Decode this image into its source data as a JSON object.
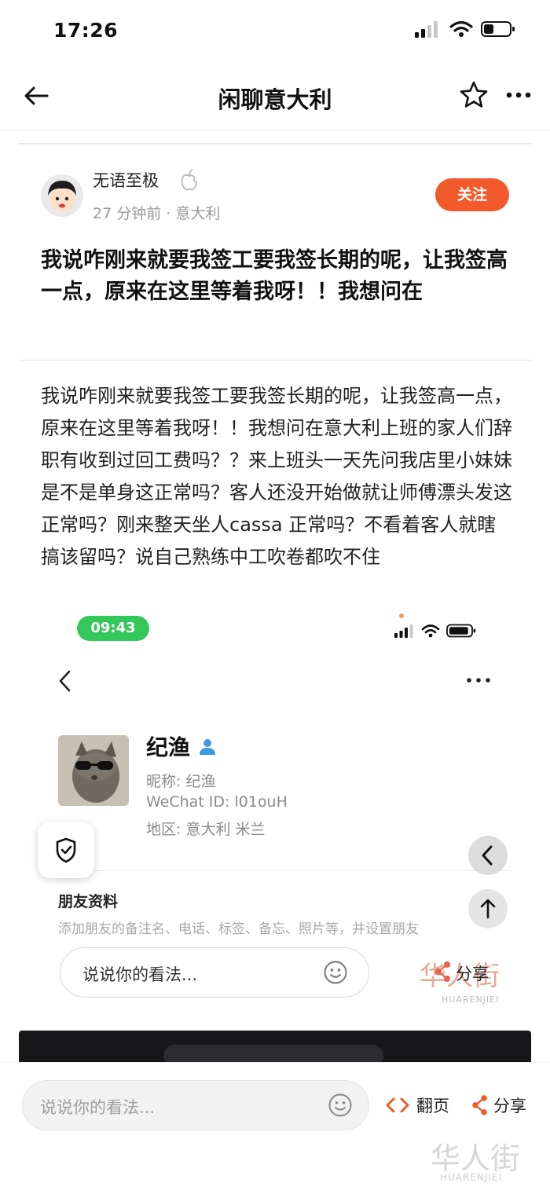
{
  "status_bar": {
    "time": "17:26"
  },
  "nav": {
    "title": "闲聊意大利"
  },
  "author": {
    "name": "无语至极",
    "meta": "27 分钟前 · 意大利",
    "follow_label": "关注"
  },
  "post": {
    "title": "我说咋刚来就要我签工要我签长期的呢，让我签高一点，原来在这里等着我呀！！我想问在",
    "body": "我说咋刚来就要我签工要我签长期的呢，让我签高一点，原来在这里等着我呀！！我想问在意大利上班的家人们辞职有收到过回工费吗？？来上班头一天先问我店里小妹妹是不是单身这正常吗？客人还没开始做就让师傅漂头发这正常吗？刚来整天坐人cassa 正常吗？不看着客人就瞎搞该留吗？说自己熟练中工吹卷都吹不住"
  },
  "embedded": {
    "time": "09:43",
    "name": "纪渔",
    "nickname": "昵称: 纪渔",
    "wechat_id": "WeChat ID: l01ouH",
    "region": "地区: 意大利 米兰",
    "friend_title": "朋友资料",
    "friend_desc": "添加朋友的备注名、电话、标签、备忘、照片等，并设置朋友",
    "comment_placeholder": "说说你的看法...",
    "share_label": "分享",
    "watermark": "华人街",
    "watermark_sub": "HUARENJIEI"
  },
  "bottom_bar": {
    "comment_placeholder": "说说你的看法...",
    "page_label": "翻页",
    "share_label": "分享",
    "watermark": "华人街",
    "watermark_sub": "HUARENJIEI"
  },
  "colors": {
    "accent": "#f25a2c",
    "green_pill": "#34c759"
  },
  "icons": [
    "back-arrow-icon",
    "star-icon",
    "more-icon",
    "apple-icon",
    "shield-icon",
    "chevron-left-icon",
    "arrow-up-icon",
    "smile-icon",
    "share-icon",
    "code-icon",
    "person-icon",
    "signal-icon",
    "wifi-icon",
    "battery-icon"
  ]
}
